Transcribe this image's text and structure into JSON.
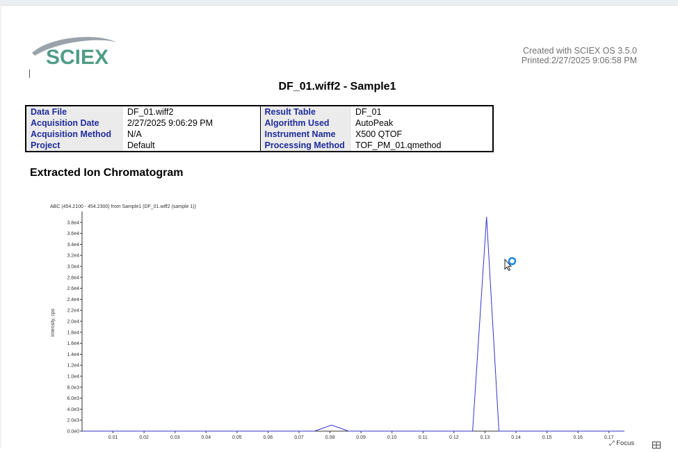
{
  "header": {
    "logo_text": "SCIEX",
    "created_with": "Created with SCIEX OS 3.5.0",
    "printed": "Printed:2/27/2025 9:06:58 PM"
  },
  "report_title": "DF_01.wiff2 - Sample1",
  "info_table": {
    "rows": [
      {
        "k1": "Data File",
        "v1": "DF_01.wiff2",
        "k2": "Result Table",
        "v2": "DF_01"
      },
      {
        "k1": "Acquisition Date",
        "v1": "2/27/2025 9:06:29 PM",
        "k2": "Algorithm Used",
        "v2": "AutoPeak"
      },
      {
        "k1": "Acquisition Method",
        "v1": "N/A",
        "k2": "Instrument Name",
        "v2": "X500 QTOF"
      },
      {
        "k1": "Project",
        "v1": "Default",
        "k2": "Processing Method",
        "v2": "TOF_PM_01.qmethod"
      }
    ]
  },
  "section_title": "Extracted Ion Chromatogram",
  "chart_data": {
    "type": "line",
    "title": "ABC (454.2100 - 454.2300) from Sample1 (DF_01.wiff2 (sample 1))",
    "xlabel": "",
    "ylabel": "Intensity, cps",
    "xlim": [
      0.0,
      0.175
    ],
    "ylim": [
      0,
      39500
    ],
    "x_ticks": [
      0.01,
      0.02,
      0.03,
      0.04,
      0.05,
      0.06,
      0.07,
      0.08,
      0.09,
      0.1,
      0.11,
      0.12,
      0.13,
      0.14,
      0.15,
      0.16,
      0.17
    ],
    "x_tick_labels": [
      "0.01",
      "0.02",
      "0.03",
      "0.04",
      "0.05",
      "0.06",
      "0.07",
      "0.08",
      "0.09",
      "0.10",
      "0.11",
      "0.12",
      "0.13",
      "0.14",
      "0.15",
      "0.16",
      "0.17"
    ],
    "y_ticks": [
      0,
      2000,
      4000,
      6000,
      8000,
      10000,
      12000,
      14000,
      16000,
      18000,
      20000,
      22000,
      24000,
      26000,
      28000,
      30000,
      32000,
      34000,
      36000,
      38000
    ],
    "y_tick_labels": [
      "0.0e0",
      "2.0e3",
      "4.0e3",
      "6.0e3",
      "8.0e3",
      "1.0e4",
      "1.2e4",
      "1.4e4",
      "1.6e4",
      "1.8e4",
      "2.0e4",
      "2.2e4",
      "2.4e4",
      "2.6e4",
      "2.8e4",
      "3.0e4",
      "3.2e4",
      "3.4e4",
      "3.6e4",
      "3.8e4"
    ],
    "grid": false,
    "series": [
      {
        "color": "#3333cc",
        "points": [
          [
            0.0,
            0
          ],
          [
            0.075,
            0
          ],
          [
            0.0805,
            1100
          ],
          [
            0.086,
            0
          ],
          [
            0.126,
            0
          ],
          [
            0.1305,
            39000
          ],
          [
            0.1345,
            0
          ],
          [
            0.175,
            0
          ]
        ]
      }
    ]
  },
  "footer": {
    "focus_label": "Focus"
  }
}
